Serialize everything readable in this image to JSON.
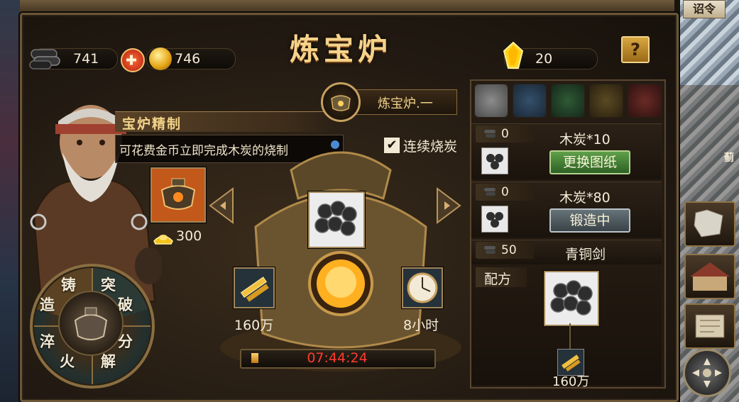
{
  "title": "炼宝炉",
  "resources": {
    "charcoal_count": "741",
    "gold_count": "746",
    "crystal_count": "20"
  },
  "help_label": "?",
  "hint": {
    "title": "宝炉精制",
    "text": "可花费金币立即完成木炭的烧制"
  },
  "furnace_name": "炼宝炉.一",
  "continuous": {
    "label": "连续烧炭",
    "checked": true,
    "check_glyph": "✔"
  },
  "recipe_cost": {
    "gold": "300"
  },
  "wheel": {
    "segments": [
      "铸",
      "突",
      "造",
      "破",
      "淬",
      "分",
      "火",
      "解"
    ]
  },
  "materials": {
    "left_label": "160万",
    "right_label": "8小时"
  },
  "timer": {
    "text": "07:44:24",
    "progress": 0.04
  },
  "gem_tabs": [
    "white-gem-tab",
    "blue-gem-tab",
    "green-gem-tab",
    "orange-gem-tab",
    "red-gem-tab"
  ],
  "recipes": [
    {
      "stock": "0",
      "name": "木炭*10",
      "button": "更换图纸",
      "button_style": "green"
    },
    {
      "stock": "0",
      "name": "木炭*80",
      "button": "锻造中",
      "button_style": "grey"
    },
    {
      "stock": "50",
      "name": "青铜剑"
    }
  ],
  "formula": {
    "label": "配方",
    "sub_label": "160万"
  },
  "side": {
    "edict_label": "诏令",
    "map_label": "蓟"
  },
  "colors": {
    "title_gold": "#f6d28a",
    "timer_red": "#ff3b2f",
    "button_green": "#4a8a3a",
    "button_grey": "#535e63"
  }
}
